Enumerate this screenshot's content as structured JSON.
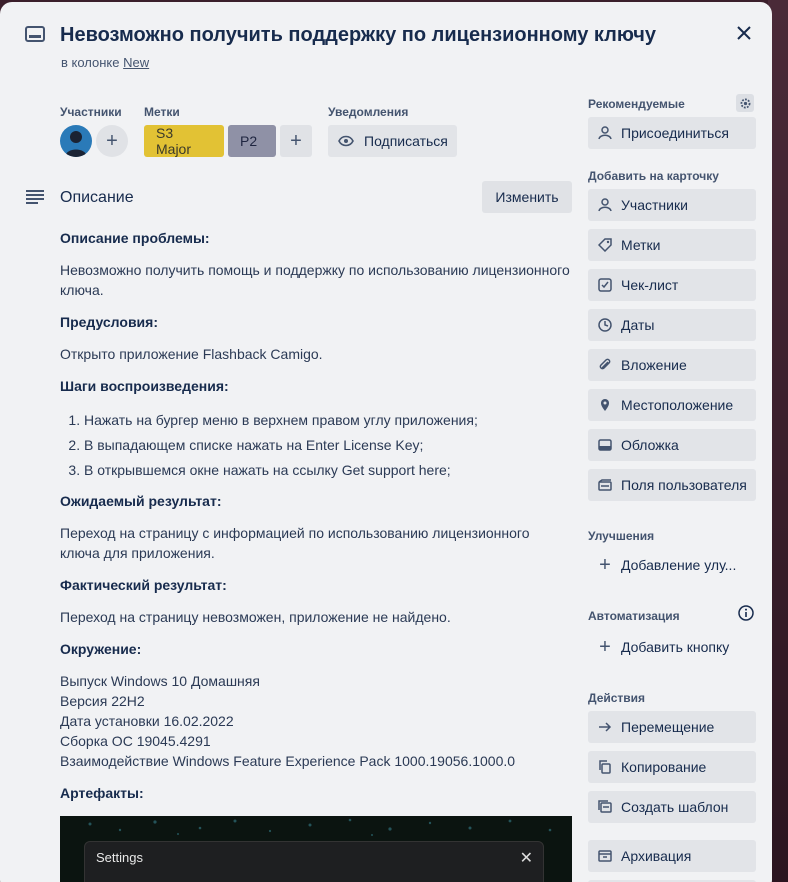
{
  "card": {
    "title": "Невозможно получить поддержку по лицензионному ключу",
    "column_prefix": "в колонке",
    "column_name": "New"
  },
  "members": {
    "label": "Участники"
  },
  "labels": {
    "label": "Метки",
    "items": [
      {
        "text": "S3 Major",
        "color": "#e2c234"
      },
      {
        "text": "P2",
        "color": "#8f91a6"
      }
    ]
  },
  "notifications": {
    "label": "Уведомления",
    "subscribe": "Подписаться"
  },
  "description": {
    "title": "Описание",
    "edit": "Изменить",
    "problem_h": "Описание проблемы:",
    "problem_text": "Невозможно получить помощь и поддержку по использованию лицензионного ключа.",
    "pre_h": "Предусловия:",
    "pre_text": "Открыто приложение Flashback Camigo.",
    "steps_h": "Шаги воспроизведения:",
    "steps": [
      "Нажать на бургер меню в верхнем правом углу приложения;",
      "В выпадающем списке нажать на Enter License Key;",
      "В открывшемся окне нажать на ссылку Get support here;"
    ],
    "expected_h": "Ожидаемый результат:",
    "expected_text": "Переход на страницу с информацией по использованию лицензионного ключа для приложения.",
    "actual_h": "Фактический результат:",
    "actual_text": "Переход на страницу невозможен, приложение не найдено.",
    "env_h": "Окружение:",
    "env_lines": [
      "Выпуск Windows 10 Домашняя",
      "Версия 22H2",
      "Дата установки 16.02.2022",
      "Сборка ОС 19045.4291",
      "Взаимодействие Windows Feature Experience Pack 1000.19056.1000.0"
    ],
    "artifacts_h": "Артефакты:",
    "screenshot_window_title": "Settings"
  },
  "sidebar": {
    "recommended": "Рекомендуемые",
    "join": "Присоединиться",
    "add_to_card": "Добавить на карточку",
    "add_items": [
      "Участники",
      "Метки",
      "Чек-лист",
      "Даты",
      "Вложение",
      "Местоположение",
      "Обложка",
      "Поля пользователя"
    ],
    "improvements": "Улучшения",
    "add_improvement": "Добавление улу...",
    "automation": "Автоматизация",
    "add_button": "Добавить кнопку",
    "actions": "Действия",
    "action_items": [
      "Перемещение",
      "Копирование",
      "Создать шаблон",
      "Архивация"
    ]
  }
}
